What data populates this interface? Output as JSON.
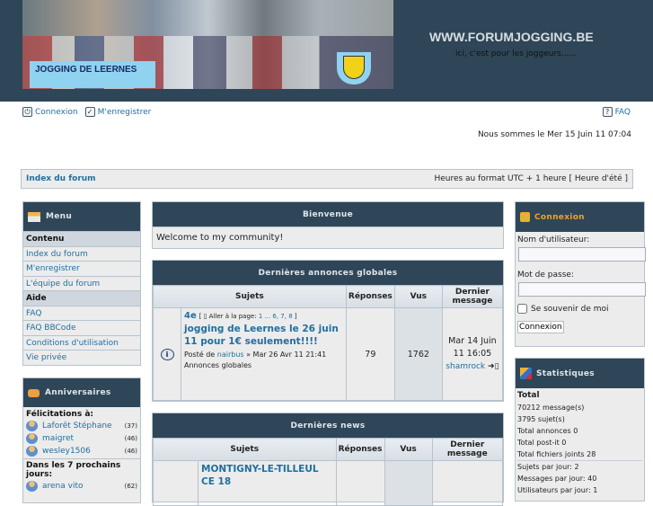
{
  "header": {
    "site_title": "WWW.FORUMJOGGING.BE",
    "subtitle": "ici, c'est pour les joggeurs......",
    "banner_text": "JOGGING DE LEERNES"
  },
  "topnav": {
    "login": "Connexion",
    "register": "M'enregistrer",
    "faq": "FAQ"
  },
  "date_text": "Nous sommes le Mer 15 Juin 11 07:04",
  "breadcrumb": {
    "index": "Index du forum",
    "timezone": "Heures au format UTC + 1 heure [ Heure d'été ]"
  },
  "menu": {
    "title": "Menu",
    "sections": [
      {
        "title": "Contenu",
        "items": [
          "Index du forum",
          "M'enregistrer",
          "L'équipe du forum"
        ]
      },
      {
        "title": "Aide",
        "items": [
          "FAQ",
          "FAQ BBCode",
          "Conditions d'utilisation",
          "Vie privée"
        ]
      }
    ]
  },
  "birthdays": {
    "title": "Anniversaires",
    "today_label": "Félicitations à:",
    "today": [
      {
        "name": "Laforêt Stéphane",
        "age": "(37)"
      },
      {
        "name": "maigret",
        "age": "(46)"
      },
      {
        "name": "wesley1506",
        "age": "(46)"
      }
    ],
    "upcoming_label": "Dans les 7 prochains jours:",
    "upcoming": [
      {
        "name": "arena vito",
        "age": "(62)"
      }
    ]
  },
  "welcome": {
    "title": "Bienvenue",
    "text": "Welcome to my community!"
  },
  "columns": {
    "topics": "Sujets",
    "replies": "Réponses",
    "views": "Vus",
    "last": "Dernier message"
  },
  "announcements": {
    "title": "Dernières annonces globales",
    "rows": [
      {
        "prefix": "4e",
        "goto": "Aller à la page:",
        "pages": "1 ... 6, 7, 8",
        "title": "jogging de Leernes le 26 juin 11 pour 1€ seulement!!!!",
        "posted_by": "Posté de",
        "author": "nairbus",
        "posted": "» Mar 26 Avr 11 21:41 Annonces globales",
        "replies": "79",
        "views": "1762",
        "last_date": "Mar 14 Juin 11 16:05",
        "last_user": "shamrock"
      }
    ]
  },
  "news": {
    "title": "Dernières news",
    "rows": [
      {
        "title": "MONTIGNY-LE-TILLEUL CE 18"
      }
    ]
  },
  "login": {
    "title": "Connexion",
    "username_label": "Nom d'utilisateur:",
    "password_label": "Mot de passe:",
    "remember": "Se souvenir de moi",
    "submit": "Connexion"
  },
  "stats": {
    "title": "Statistiques",
    "total": "Total",
    "messages": "70212 message(s)",
    "topics": "3795 sujet(s)",
    "announces": "Total annonces 0",
    "postits": "Total post-it 0",
    "attachments": "Total fichiers joints 28",
    "topics_day": "Sujets par jour: 2",
    "messages_day": "Messages par jour: 40",
    "users_day": "Utilisateurs par jour: 1"
  }
}
